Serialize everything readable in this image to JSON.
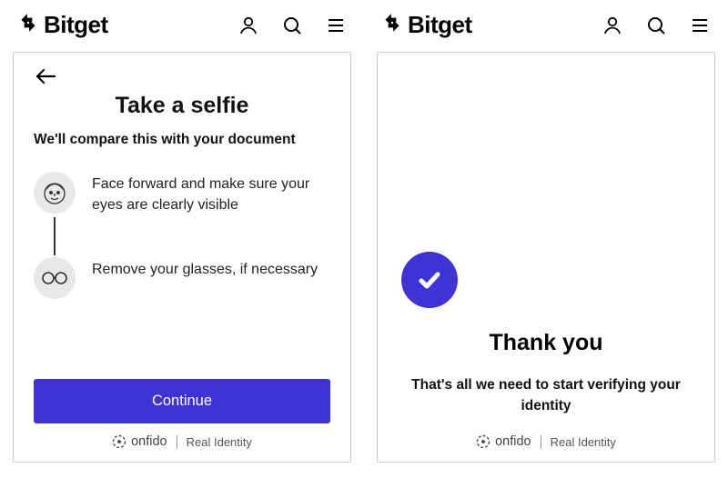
{
  "brand_name": "Bitget",
  "screens": [
    {
      "title": "Take a selfie",
      "subtitle": "We'll compare this with your document",
      "tips": [
        "Face forward and make sure your eyes are clearly visible",
        "Remove your glasses, if necessary"
      ],
      "continue_label": "Continue"
    },
    {
      "title": "Thank you",
      "subtitle": "That's all we need to start verifying your identity"
    }
  ],
  "footer": {
    "provider": "onfido",
    "tagline": "Real Identity"
  },
  "colors": {
    "primary": "#3f33d8"
  }
}
